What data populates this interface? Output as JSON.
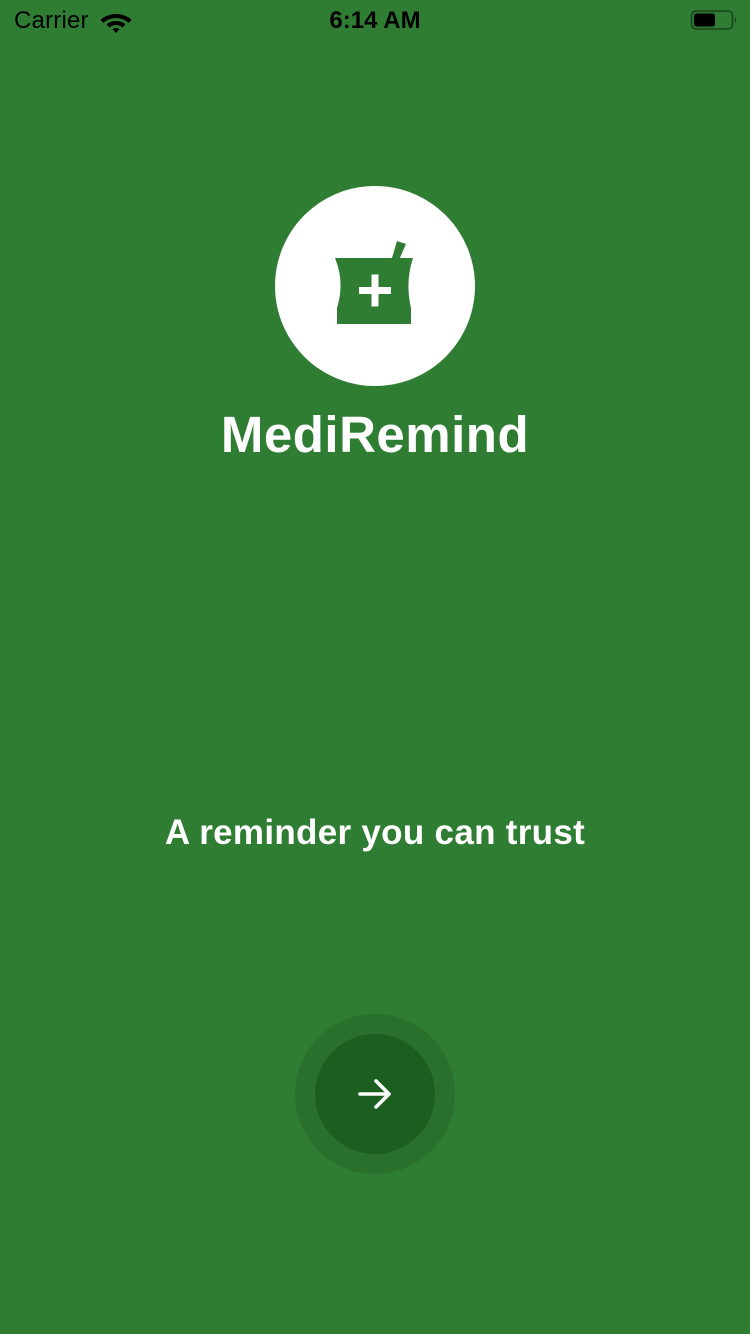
{
  "status_bar": {
    "carrier": "Carrier",
    "time": "6:14 AM",
    "icons": [
      "wifi-icon",
      "battery-icon"
    ]
  },
  "app": {
    "logo_icon": "mortar-pestle-plus-icon",
    "title": "MediRemind",
    "tagline": "A reminder you can trust"
  },
  "actions": {
    "next_icon": "arrow-right-icon"
  },
  "colors": {
    "background": "#2f7d32",
    "logo_circle": "#ffffff",
    "button_ring": "#2a702d",
    "button": "#1c5e20",
    "text": "#ffffff"
  }
}
